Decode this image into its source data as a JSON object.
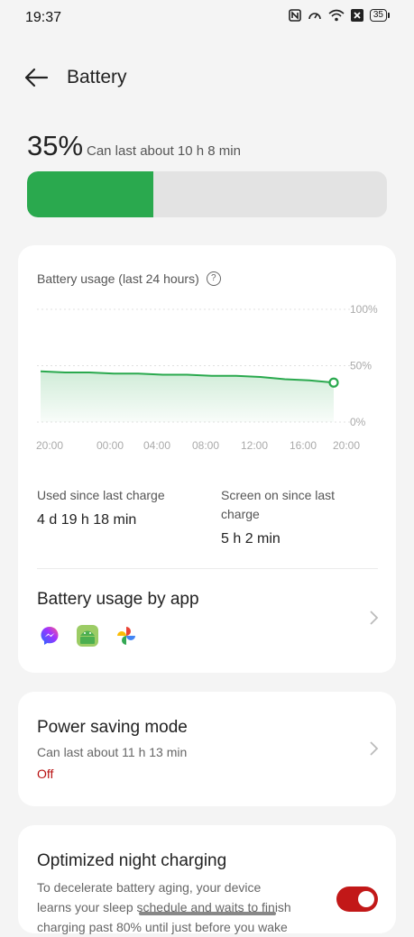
{
  "status_bar": {
    "time": "19:37",
    "battery_level": "35"
  },
  "header": {
    "title": "Battery"
  },
  "battery": {
    "percent_text": "35%",
    "percent_value": 0.35,
    "estimate": "Can last about 10 h 8 min",
    "fill_color": "#2aa94e"
  },
  "usage_card": {
    "title": "Battery usage (last 24 hours)",
    "used_since_label": "Used since last charge",
    "used_since_value": "4 d 19 h 18 min",
    "screen_on_label": "Screen on since last charge",
    "screen_on_value": "5 h 2 min",
    "by_app_title": "Battery usage by app",
    "app_icons": [
      "messenger-icon",
      "android-icon",
      "google-photos-icon"
    ]
  },
  "chart_data": {
    "type": "area",
    "title": "Battery usage (last 24 hours)",
    "x_tick_labels": [
      "20:00",
      "00:00",
      "04:00",
      "08:00",
      "12:00",
      "16:00",
      "20:00"
    ],
    "y_tick_labels": [
      "100%",
      "50%",
      "0%"
    ],
    "ylim": [
      0,
      100
    ],
    "x": [
      0,
      2,
      4,
      6,
      8,
      10,
      12,
      14,
      16,
      18,
      20,
      22,
      24
    ],
    "values": [
      45,
      44,
      44,
      43,
      43,
      42,
      42,
      41,
      41,
      40,
      38,
      37,
      35
    ],
    "grid": true,
    "color": "#2aa94e"
  },
  "power_saving": {
    "title": "Power saving mode",
    "estimate": "Can last about 11 h 13 min",
    "status": "Off"
  },
  "night_charging": {
    "title": "Optimized night charging",
    "line1": "To decelerate battery aging, your device",
    "line2": "learns your sleep schedule and waits to finish",
    "line3": "charging past 80% until just before you wake",
    "toggle_on": true,
    "toggle_color": "#c21818"
  }
}
